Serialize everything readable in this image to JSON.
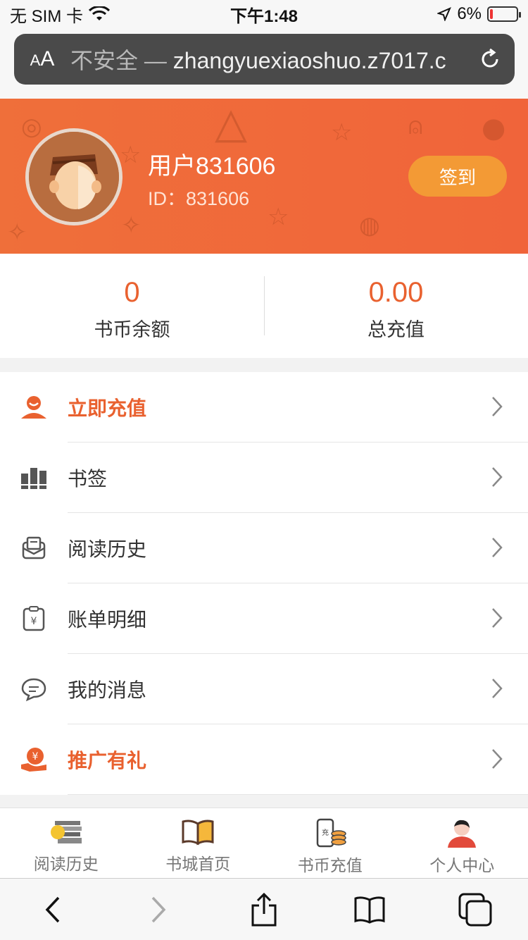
{
  "status_bar": {
    "carrier": "无 SIM 卡",
    "time": "下午1:48",
    "battery": "6%"
  },
  "address_bar": {
    "aa_small": "A",
    "aa_large": "A",
    "insecure": "不安全",
    "separator": " — ",
    "url": "zhangyuexiaoshuo.z7017.c"
  },
  "profile": {
    "username": "用户831606",
    "id_label": "ID：",
    "id_value": "831606",
    "signin_label": "签到"
  },
  "stats": {
    "balance_value": "0",
    "balance_label": "书币余额",
    "total_value": "0.00",
    "total_label": "总充值"
  },
  "menu": [
    {
      "label": "立即充值",
      "icon": "person-icon",
      "highlight": true
    },
    {
      "label": "书签",
      "icon": "bookmark-bars-icon",
      "highlight": false
    },
    {
      "label": "阅读历史",
      "icon": "envelope-icon",
      "highlight": false
    },
    {
      "label": "账单明细",
      "icon": "bill-icon",
      "highlight": false
    },
    {
      "label": "我的消息",
      "icon": "chat-icon",
      "highlight": false
    },
    {
      "label": "推广有礼",
      "icon": "gift-hand-icon",
      "highlight": true
    }
  ],
  "tabs": [
    {
      "label": "阅读历史",
      "icon": "books-stack-icon"
    },
    {
      "label": "书城首页",
      "icon": "open-book-icon"
    },
    {
      "label": "书币充值",
      "icon": "phone-coins-icon"
    },
    {
      "label": "个人中心",
      "icon": "user-avatar-icon"
    }
  ],
  "tab_badge": "充",
  "colors": {
    "accent": "#e9612f",
    "header": "#ef6a3a",
    "signin": "#f39a35"
  }
}
